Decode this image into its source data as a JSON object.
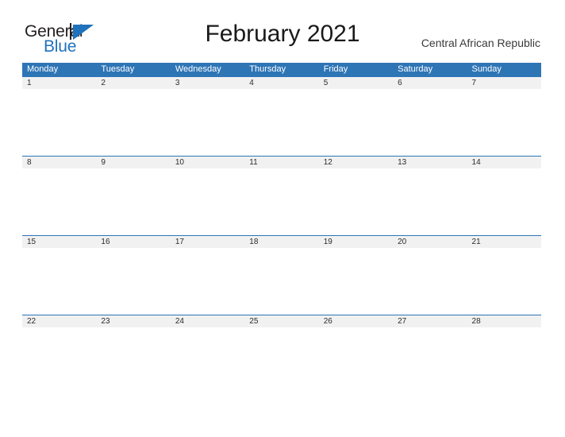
{
  "branding": {
    "logo_primary": "General",
    "logo_secondary": "Blue",
    "logo_triangle_icon": "triangle-icon",
    "accent_color": "#2e75b6",
    "logo_blue": "#1f72bb",
    "logo_black": "#231f20"
  },
  "header": {
    "title": "February 2021",
    "subtitle": "Central African Republic"
  },
  "calendar": {
    "weekday_header_bg": "#2e75b6",
    "date_band_bg": "#f1f1f1",
    "weekdays": [
      "Monday",
      "Tuesday",
      "Wednesday",
      "Thursday",
      "Friday",
      "Saturday",
      "Sunday"
    ],
    "weeks": [
      {
        "days": [
          {
            "date": "1",
            "events": ""
          },
          {
            "date": "2",
            "events": ""
          },
          {
            "date": "3",
            "events": ""
          },
          {
            "date": "4",
            "events": ""
          },
          {
            "date": "5",
            "events": ""
          },
          {
            "date": "6",
            "events": ""
          },
          {
            "date": "7",
            "events": ""
          }
        ]
      },
      {
        "days": [
          {
            "date": "8",
            "events": ""
          },
          {
            "date": "9",
            "events": ""
          },
          {
            "date": "10",
            "events": ""
          },
          {
            "date": "11",
            "events": ""
          },
          {
            "date": "12",
            "events": ""
          },
          {
            "date": "13",
            "events": ""
          },
          {
            "date": "14",
            "events": ""
          }
        ]
      },
      {
        "days": [
          {
            "date": "15",
            "events": ""
          },
          {
            "date": "16",
            "events": ""
          },
          {
            "date": "17",
            "events": ""
          },
          {
            "date": "18",
            "events": ""
          },
          {
            "date": "19",
            "events": ""
          },
          {
            "date": "20",
            "events": ""
          },
          {
            "date": "21",
            "events": ""
          }
        ]
      },
      {
        "days": [
          {
            "date": "22",
            "events": ""
          },
          {
            "date": "23",
            "events": ""
          },
          {
            "date": "24",
            "events": ""
          },
          {
            "date": "25",
            "events": ""
          },
          {
            "date": "26",
            "events": ""
          },
          {
            "date": "27",
            "events": ""
          },
          {
            "date": "28",
            "events": ""
          }
        ]
      }
    ]
  }
}
